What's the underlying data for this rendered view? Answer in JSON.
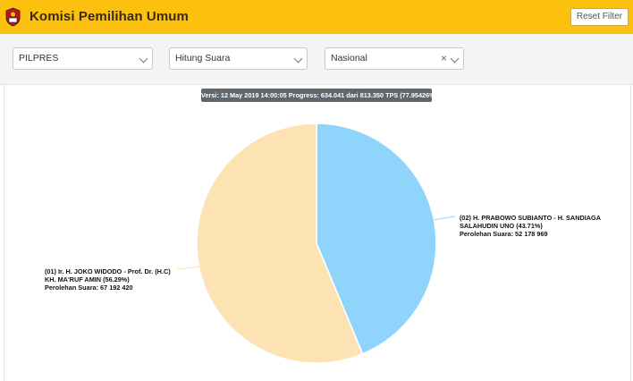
{
  "header": {
    "title": "Komisi Pemilihan Umum",
    "reset_label": "Reset Filter"
  },
  "filters": {
    "election": "PILPRES",
    "mode": "Hitung Suara",
    "region": "Nasional",
    "clear_symbol": "×"
  },
  "version_info": "Versi: 12 May 2019 14:00:05 Progress: 634.041 dari 813.350 TPS (77.95426%)",
  "colors": {
    "header_bg": "#fcc10f",
    "slice_01": "#fde3b3",
    "slice_02": "#8fd4fb"
  },
  "chart_data": {
    "type": "pie",
    "title": "",
    "slices": [
      {
        "candidate": "(01) Ir. H. JOKO WIDODO - Prof. Dr. (H.C)",
        "candidate_line2": "KH. MA'RUF AMIN (56.29%)",
        "votes_label": "Perolehan Suara: 67 192 420",
        "percent": 56.29,
        "votes": 67192420,
        "color": "#fde3b3"
      },
      {
        "candidate": "(02) H. PRABOWO SUBIANTO - H. SANDIAGA",
        "candidate_line2": "SALAHUDIN UNO (43.71%)",
        "votes_label": "Perolehan Suara: 52 178 969",
        "percent": 43.71,
        "votes": 52178969,
        "color": "#8fd4fb"
      }
    ]
  }
}
